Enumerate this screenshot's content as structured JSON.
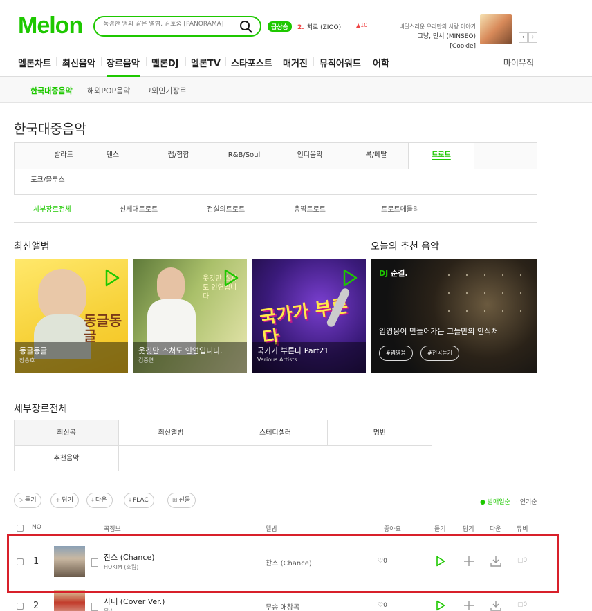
{
  "header": {
    "logo": "Melon",
    "search_placeholder": "풍경한 영화 같은 앨범, 김호중 [PANORAMA]",
    "live_badge": "급상승",
    "rank_no": "2.",
    "rank_title": "치로 (ZIOO)",
    "rank_change": "10",
    "promo_top": "비밀스러운 우리만의 사랑 이야기",
    "promo_bottom": "그냥, 민서 (MINSEO) [Cookie]",
    "prev": "‹",
    "next": "›"
  },
  "gnb": {
    "items": [
      "멜론차트",
      "최신음악",
      "장르음악",
      "멜론DJ",
      "멜론TV",
      "스타포스트",
      "매거진",
      "뮤직어워드",
      "어학"
    ],
    "right": "마이뮤직"
  },
  "lnb": {
    "items": [
      "한국대중음악",
      "해외POP음악",
      "그외인기장르"
    ]
  },
  "page_title": "한국대중음악",
  "genres": [
    "발라드",
    "댄스",
    "랩/힙합",
    "R&B/Soul",
    "인디음악",
    "록/메탈",
    "트로트",
    "포크/블루스"
  ],
  "sub_genres": [
    "세부장르전체",
    "신세대트로트",
    "전설의트로트",
    "뽕짝트로트",
    "트로트메들리"
  ],
  "new_albums": {
    "title": "최신앨범",
    "items": [
      {
        "title": "동글동글",
        "artist": "장송호",
        "cover_text": "동글동글"
      },
      {
        "title": "웃깃만 스쳐도 인연입니다.",
        "artist": "김중연",
        "cover_text": "웃깃만 스쳐도 인연입니다"
      },
      {
        "title": "국가가 부른다 Part21",
        "artist": "Various Artists",
        "cover_text": "국가가 부른다"
      }
    ]
  },
  "recommend": {
    "title": "오늘의 추천 음악",
    "dj_label": "DJ",
    "dj_name": "순결.",
    "desc": "임영웅이 만들어가는 그들만의 안식처",
    "tags": [
      "#임영웅",
      "#전곡듣기"
    ]
  },
  "detail": {
    "title": "세부장르전체",
    "sort_tabs": [
      "최신곡",
      "최신앨범",
      "스테디셀러",
      "명반",
      "추천음악"
    ]
  },
  "actions": [
    "듣기",
    "담기",
    "다운",
    "FLAC",
    "선물"
  ],
  "order": [
    "발매일순",
    "인기순"
  ],
  "columns": [
    "NO",
    "곡정보",
    "앨범",
    "좋아요",
    "듣기",
    "담기",
    "다운",
    "뮤비"
  ],
  "rows": [
    {
      "no": "1",
      "title": "찬스 (Chance)",
      "artist": "HOKIM (호킴)",
      "album": "찬스 (Chance)",
      "likes": "0",
      "mv": "0"
    },
    {
      "no": "2",
      "title": "사내 (Cover Ver.)",
      "artist": "무송",
      "album": "무송 애창곡",
      "likes": "0",
      "mv": "0"
    }
  ],
  "colors": {
    "accent": "#1ec800",
    "highlight": "#d8202a"
  }
}
